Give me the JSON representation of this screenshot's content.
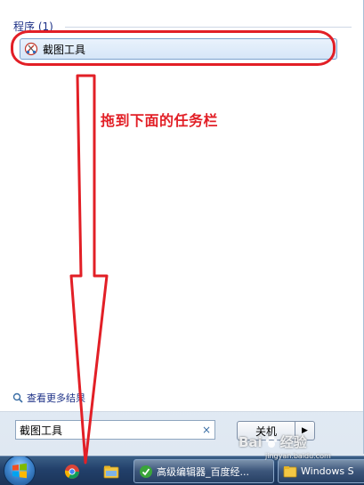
{
  "start_menu": {
    "section_header": "程序 (1)",
    "programs": [
      {
        "label": "截图工具",
        "icon": "snipping-tool-icon"
      }
    ],
    "see_more_results": "查看更多结果",
    "search": {
      "value": "截图工具",
      "clear_label": "×"
    },
    "shutdown": {
      "label": "关机",
      "arrow_label": "▶"
    }
  },
  "annotation": {
    "text": "拖到下面的任务栏",
    "color": "#e21f26"
  },
  "taskbar": {
    "start_icon": "windows-orb-icon",
    "pinned": [
      {
        "icon": "chrome-icon"
      },
      {
        "icon": "file-explorer-icon"
      }
    ],
    "tasks": [
      {
        "label": "高级编辑器_百度经...",
        "icon": "editor-icon"
      },
      {
        "label": "Windows S",
        "icon": "folder-icon"
      }
    ]
  },
  "watermark": {
    "brand": "Bai",
    "brand_suffix": "经验",
    "url": "jingyan.baidu.com"
  }
}
